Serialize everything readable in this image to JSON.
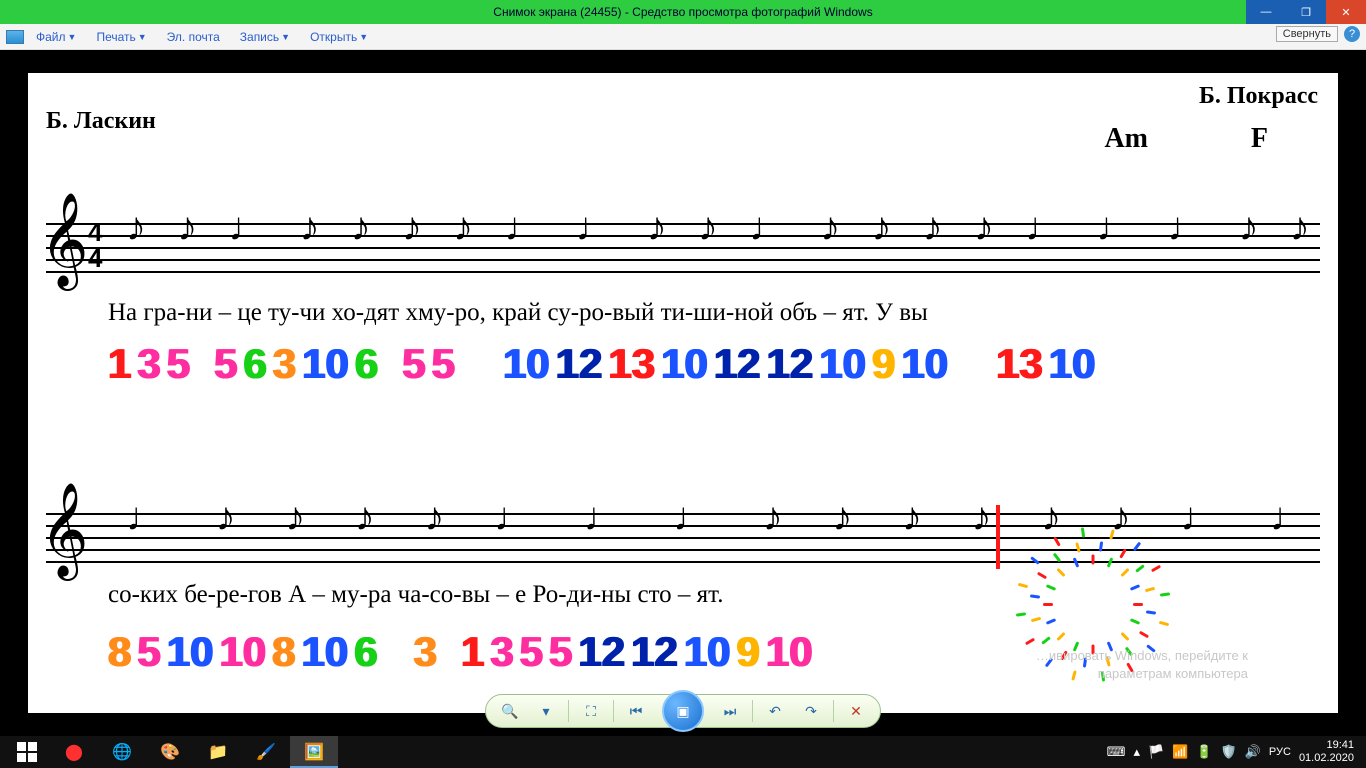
{
  "window": {
    "title": "Снимок экрана (24455) - Средство просмотра фотографий Windows"
  },
  "menu": {
    "file": "Файл",
    "print": "Печать",
    "email": "Эл. почта",
    "burn": "Запись",
    "open": "Открыть",
    "collapse": "Свернуть"
  },
  "sheet": {
    "author_left": "Б. Ласкин",
    "author_right": "Б. Покрасс",
    "chord1": "Am",
    "chord2": "F",
    "timesig_top": "4",
    "timesig_bot": "4",
    "lyrics1": "На гра-ни – це ту-чи хо-дят хму-ро,    край су-ро-вый ти-ши-ной объ – ят.        У вы",
    "lyrics2": "со-ких бе-ре-гов А – му-ра      ча-со-вы – е Ро-ди-ны сто – ят.",
    "nums1": [
      {
        "v": "1",
        "c": "c-red"
      },
      {
        "v": "3",
        "c": "c-pink"
      },
      {
        "v": "5",
        "c": "c-pink"
      },
      {
        "v": " ",
        "c": ""
      },
      {
        "v": "5",
        "c": "c-pink"
      },
      {
        "v": "6",
        "c": "c-green"
      },
      {
        "v": "3",
        "c": "c-orange"
      },
      {
        "v": "10",
        "c": "c-blue"
      },
      {
        "v": "6",
        "c": "c-green"
      },
      {
        "v": " ",
        "c": ""
      },
      {
        "v": "5",
        "c": "c-pink"
      },
      {
        "v": "5",
        "c": "c-pink"
      },
      {
        "v": "   ",
        "c": ""
      },
      {
        "v": "10",
        "c": "c-blue"
      },
      {
        "v": "12",
        "c": "c-dblue"
      },
      {
        "v": "13",
        "c": "c-red"
      },
      {
        "v": "10",
        "c": "c-blue"
      },
      {
        "v": "12",
        "c": "c-dblue"
      },
      {
        "v": "12",
        "c": "c-dblue"
      },
      {
        "v": "10",
        "c": "c-blue"
      },
      {
        "v": "9",
        "c": "c-yellow"
      },
      {
        "v": "10",
        "c": "c-blue"
      },
      {
        "v": "   ",
        "c": ""
      },
      {
        "v": "13",
        "c": "c-red"
      },
      {
        "v": "10",
        "c": "c-blue"
      }
    ],
    "nums2": [
      {
        "v": "8",
        "c": "c-orange"
      },
      {
        "v": "5",
        "c": "c-pink"
      },
      {
        "v": "10",
        "c": "c-blue"
      },
      {
        "v": "10",
        "c": "c-pink"
      },
      {
        "v": "8",
        "c": "c-orange"
      },
      {
        "v": "10",
        "c": "c-blue"
      },
      {
        "v": "6",
        "c": "c-green"
      },
      {
        "v": "  ",
        "c": ""
      },
      {
        "v": "3",
        "c": "c-orange"
      },
      {
        "v": " ",
        "c": ""
      },
      {
        "v": "1",
        "c": "c-red"
      },
      {
        "v": "3",
        "c": "c-pink"
      },
      {
        "v": "5",
        "c": "c-pink"
      },
      {
        "v": "5",
        "c": "c-pink"
      },
      {
        "v": "12",
        "c": "c-dblue"
      },
      {
        "v": "12",
        "c": "c-dblue"
      },
      {
        "v": "10",
        "c": "c-blue"
      },
      {
        "v": "9",
        "c": "c-yellow"
      },
      {
        "v": "10",
        "c": "c-pink"
      }
    ]
  },
  "watermark": {
    "line1": "…ивировать Windows, перейдите к",
    "line2": "параметрам компьютера"
  },
  "tray": {
    "lang": "РУС",
    "time": "19:41",
    "date": "01.02.2020"
  }
}
